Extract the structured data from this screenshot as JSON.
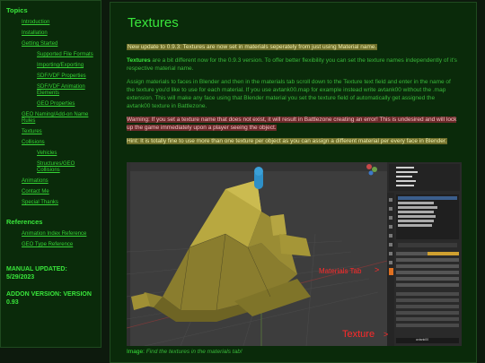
{
  "sidebar": {
    "topics_heading": "Topics",
    "items": [
      {
        "label": "Introduction",
        "level": 1
      },
      {
        "label": "Installation",
        "level": 1
      },
      {
        "label": "Getting Started",
        "level": 1
      },
      {
        "label": "Supported File Formats",
        "level": 2
      },
      {
        "label": "Importing/Exporting",
        "level": 2
      },
      {
        "label": "SDF/VDF Properties",
        "level": 2
      },
      {
        "label": "SDF/VDF Animation Elements",
        "level": 2
      },
      {
        "label": "GEO Properties",
        "level": 2
      },
      {
        "label": "GEO Naming/Add-on Name Rules",
        "level": 1
      },
      {
        "label": "Textures",
        "level": 1
      },
      {
        "label": "Collisions",
        "level": 1
      },
      {
        "label": "Vehicles",
        "level": 2
      },
      {
        "label": "Structures/GEO Collisions",
        "level": 2
      },
      {
        "label": "Animations",
        "level": 1
      },
      {
        "label": "Contact Me",
        "level": 1
      },
      {
        "label": "Special Thanks",
        "level": 1
      }
    ],
    "references_heading": "References",
    "references": [
      {
        "label": "Animation Index Reference"
      },
      {
        "label": "GEO Type Reference"
      }
    ],
    "manual_updated": "MANUAL UPDATED: 5/29/2023",
    "addon_version": "ADDON VERSION: VERSION 0.93"
  },
  "main": {
    "title": "Textures",
    "update_note": "New update to 0.9.3: Textures are now set in materials seperately from just using Material name.",
    "p1_bold": "Textures",
    "p1_rest": " are a bit different now for the 0.9.3 version. To offer better flexibility you can set the texture names independently of it's respective material name.",
    "p2": "Assign materials to faces in Blender and then in the materials tab scroll down to the Texture text field and enter in the name of the texture you'd like to use for each material. If you use avtank00.map for example instead write avtank00 without the .map extension. This will make any face using that Blender material you set the texture field of automatically get assigned the avtank00 texture in Battlezone.",
    "warning": "Warning: If you set a texture name that does not exist, it will result in Battlezone creating an error! This is undesired and will lock up the game immediately upon a player seeing the object.",
    "hint": "Hint: It is totally fine to use more than one texture per object as you can assign a different material per every face in Blender.",
    "screenshot": {
      "materials_tab_annotation": "Materials Tab",
      "arrow_glyph": ">",
      "texture_annotation": "Texture",
      "texture_field_value": "avtank00"
    },
    "caption_label": "Image:",
    "caption_text": "Find the textures in the materials tab!"
  },
  "colors": {
    "page_bg": "#0d1a0d",
    "panel_bg": "#0a2a0a",
    "accent_green": "#39e63b",
    "highlight_yellow": "#6f6f2a",
    "warning_red": "#6b2a2a",
    "annotation_red": "#ff2a2a"
  }
}
